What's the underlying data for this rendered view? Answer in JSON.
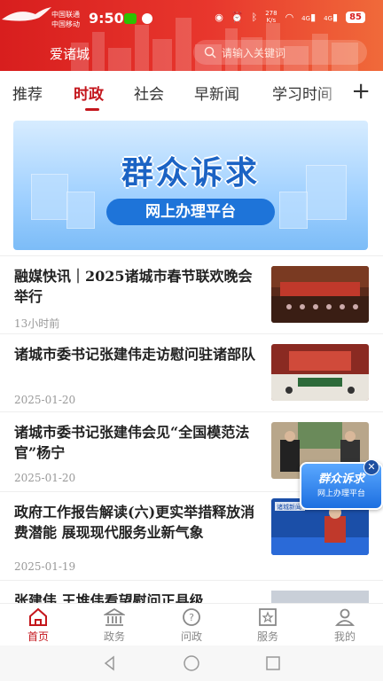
{
  "status_bar": {
    "carrier1": "中国联通",
    "carrier2": "中国移动",
    "time": "9:50",
    "net_speed_value": "278",
    "net_speed_unit": "K/s",
    "signal1": "4G",
    "signal2": "4G",
    "battery": "85"
  },
  "header": {
    "app_name": "爱诸城",
    "search_placeholder": "请输入关键词"
  },
  "tabs": [
    {
      "label": "推荐"
    },
    {
      "label": "时政"
    },
    {
      "label": "社会"
    },
    {
      "label": "早新闻"
    },
    {
      "label": "学习时间"
    }
  ],
  "active_tab": "时政",
  "banner": {
    "title": "群众诉求",
    "subtitle": "网上办理平台"
  },
  "news": [
    {
      "title": "融媒快讯｜2025诸城市春节联欢晚会举行",
      "date": "13小时前"
    },
    {
      "title": "诸城市委书记张建伟走访慰问驻诸部队",
      "date": "2025-01-20"
    },
    {
      "title": "诸城市委书记张建伟会见“全国模范法官”杨宁",
      "date": "2025-01-20"
    },
    {
      "title": "政府工作报告解读(六)更实举措释放消费潜能 展现现代服务业新气象",
      "date": "2025-01-19"
    },
    {
      "title": "张建伟 王堆伟看望慰问正县级"
    }
  ],
  "float_ad": {
    "title": "群众诉求",
    "subtitle": "网上办理平台"
  },
  "thumb4_label": "诸城新闻",
  "bottom_nav": [
    {
      "label": "首页"
    },
    {
      "label": "政务"
    },
    {
      "label": "问政"
    },
    {
      "label": "服务"
    },
    {
      "label": "我的"
    }
  ],
  "colors": {
    "brand_red": "#c4161c",
    "header_gradient_start": "#d81e1e",
    "header_gradient_end": "#f06a3a",
    "banner_blue": "#1b63c4"
  }
}
